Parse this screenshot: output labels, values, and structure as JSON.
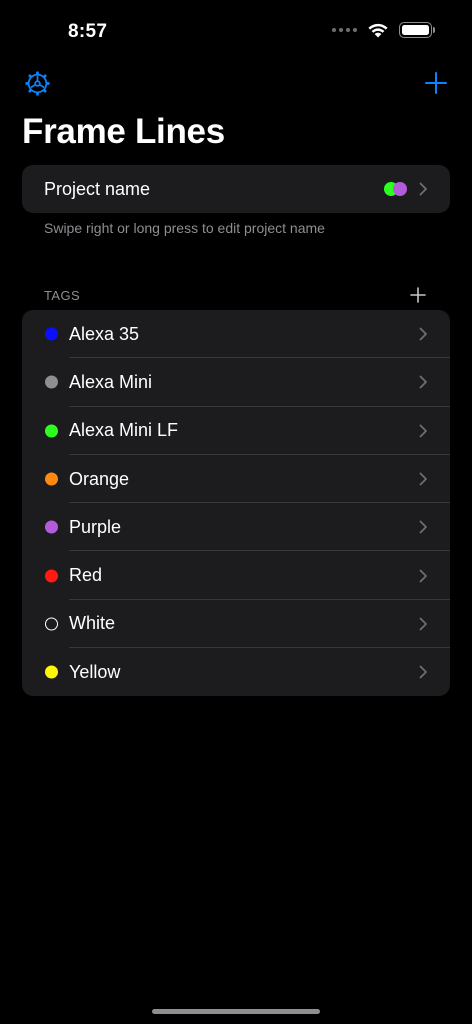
{
  "status_bar": {
    "time": "8:57"
  },
  "nav": {
    "title": "Frame Lines",
    "settings_icon": "gear-icon",
    "add_icon": "plus-icon"
  },
  "project": {
    "label": "Project name",
    "dot_colors": [
      "#2cff1f",
      "#b45bdc"
    ],
    "hint": "Swipe right or long press to edit project name"
  },
  "tags": {
    "header": "TAGS",
    "items": [
      {
        "label": "Alexa 35",
        "color": "#0a10ff",
        "outline": false
      },
      {
        "label": "Alexa Mini",
        "color": "#8e8e93",
        "outline": false
      },
      {
        "label": "Alexa Mini LF",
        "color": "#2cff1f",
        "outline": false
      },
      {
        "label": "Orange",
        "color": "#ff8a0f",
        "outline": false
      },
      {
        "label": "Purple",
        "color": "#b45bdc",
        "outline": false
      },
      {
        "label": "Red",
        "color": "#ff1a12",
        "outline": false
      },
      {
        "label": "White",
        "color": "#ffffff",
        "outline": true
      },
      {
        "label": "Yellow",
        "color": "#fff60a",
        "outline": false
      }
    ]
  },
  "colors": {
    "accent": "#0a84ff",
    "card": "#1c1c1e",
    "secondary_text": "#8e8e93"
  }
}
